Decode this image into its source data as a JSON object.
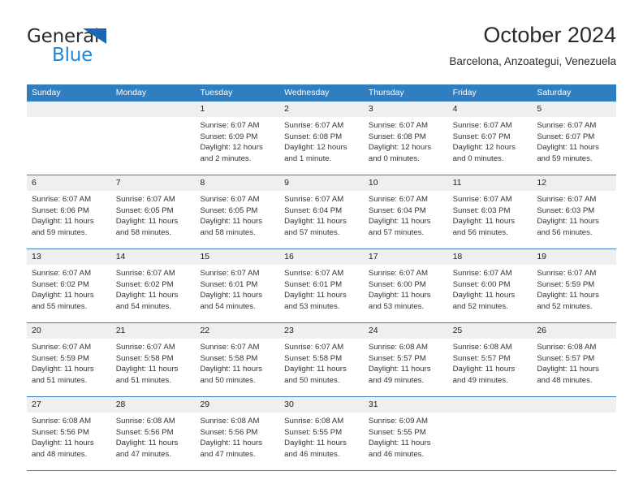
{
  "brand": {
    "word1": "General",
    "word2": "Blue",
    "triangle_color": "#1a68b3",
    "blue_text_color": "#1f86d8"
  },
  "header": {
    "title": "October 2024",
    "subtitle": "Barcelona, Anzoategui, Venezuela"
  },
  "colors": {
    "header_row_bg": "#2f7ec1",
    "header_row_text": "#ffffff",
    "daynum_band_bg": "#efefef",
    "week_divider": "#3a7ebf",
    "cell_bg": "#ffffff",
    "body_text": "#333333"
  },
  "weekdays": [
    "Sunday",
    "Monday",
    "Tuesday",
    "Wednesday",
    "Thursday",
    "Friday",
    "Saturday"
  ],
  "weeks": [
    [
      {
        "day": "",
        "lines": []
      },
      {
        "day": "",
        "lines": []
      },
      {
        "day": "1",
        "lines": [
          "Sunrise: 6:07 AM",
          "Sunset: 6:09 PM",
          "Daylight: 12 hours",
          "and 2 minutes."
        ]
      },
      {
        "day": "2",
        "lines": [
          "Sunrise: 6:07 AM",
          "Sunset: 6:08 PM",
          "Daylight: 12 hours",
          "and 1 minute."
        ]
      },
      {
        "day": "3",
        "lines": [
          "Sunrise: 6:07 AM",
          "Sunset: 6:08 PM",
          "Daylight: 12 hours",
          "and 0 minutes."
        ]
      },
      {
        "day": "4",
        "lines": [
          "Sunrise: 6:07 AM",
          "Sunset: 6:07 PM",
          "Daylight: 12 hours",
          "and 0 minutes."
        ]
      },
      {
        "day": "5",
        "lines": [
          "Sunrise: 6:07 AM",
          "Sunset: 6:07 PM",
          "Daylight: 11 hours",
          "and 59 minutes."
        ]
      }
    ],
    [
      {
        "day": "6",
        "lines": [
          "Sunrise: 6:07 AM",
          "Sunset: 6:06 PM",
          "Daylight: 11 hours",
          "and 59 minutes."
        ]
      },
      {
        "day": "7",
        "lines": [
          "Sunrise: 6:07 AM",
          "Sunset: 6:05 PM",
          "Daylight: 11 hours",
          "and 58 minutes."
        ]
      },
      {
        "day": "8",
        "lines": [
          "Sunrise: 6:07 AM",
          "Sunset: 6:05 PM",
          "Daylight: 11 hours",
          "and 58 minutes."
        ]
      },
      {
        "day": "9",
        "lines": [
          "Sunrise: 6:07 AM",
          "Sunset: 6:04 PM",
          "Daylight: 11 hours",
          "and 57 minutes."
        ]
      },
      {
        "day": "10",
        "lines": [
          "Sunrise: 6:07 AM",
          "Sunset: 6:04 PM",
          "Daylight: 11 hours",
          "and 57 minutes."
        ]
      },
      {
        "day": "11",
        "lines": [
          "Sunrise: 6:07 AM",
          "Sunset: 6:03 PM",
          "Daylight: 11 hours",
          "and 56 minutes."
        ]
      },
      {
        "day": "12",
        "lines": [
          "Sunrise: 6:07 AM",
          "Sunset: 6:03 PM",
          "Daylight: 11 hours",
          "and 56 minutes."
        ]
      }
    ],
    [
      {
        "day": "13",
        "lines": [
          "Sunrise: 6:07 AM",
          "Sunset: 6:02 PM",
          "Daylight: 11 hours",
          "and 55 minutes."
        ]
      },
      {
        "day": "14",
        "lines": [
          "Sunrise: 6:07 AM",
          "Sunset: 6:02 PM",
          "Daylight: 11 hours",
          "and 54 minutes."
        ]
      },
      {
        "day": "15",
        "lines": [
          "Sunrise: 6:07 AM",
          "Sunset: 6:01 PM",
          "Daylight: 11 hours",
          "and 54 minutes."
        ]
      },
      {
        "day": "16",
        "lines": [
          "Sunrise: 6:07 AM",
          "Sunset: 6:01 PM",
          "Daylight: 11 hours",
          "and 53 minutes."
        ]
      },
      {
        "day": "17",
        "lines": [
          "Sunrise: 6:07 AM",
          "Sunset: 6:00 PM",
          "Daylight: 11 hours",
          "and 53 minutes."
        ]
      },
      {
        "day": "18",
        "lines": [
          "Sunrise: 6:07 AM",
          "Sunset: 6:00 PM",
          "Daylight: 11 hours",
          "and 52 minutes."
        ]
      },
      {
        "day": "19",
        "lines": [
          "Sunrise: 6:07 AM",
          "Sunset: 5:59 PM",
          "Daylight: 11 hours",
          "and 52 minutes."
        ]
      }
    ],
    [
      {
        "day": "20",
        "lines": [
          "Sunrise: 6:07 AM",
          "Sunset: 5:59 PM",
          "Daylight: 11 hours",
          "and 51 minutes."
        ]
      },
      {
        "day": "21",
        "lines": [
          "Sunrise: 6:07 AM",
          "Sunset: 5:58 PM",
          "Daylight: 11 hours",
          "and 51 minutes."
        ]
      },
      {
        "day": "22",
        "lines": [
          "Sunrise: 6:07 AM",
          "Sunset: 5:58 PM",
          "Daylight: 11 hours",
          "and 50 minutes."
        ]
      },
      {
        "day": "23",
        "lines": [
          "Sunrise: 6:07 AM",
          "Sunset: 5:58 PM",
          "Daylight: 11 hours",
          "and 50 minutes."
        ]
      },
      {
        "day": "24",
        "lines": [
          "Sunrise: 6:08 AM",
          "Sunset: 5:57 PM",
          "Daylight: 11 hours",
          "and 49 minutes."
        ]
      },
      {
        "day": "25",
        "lines": [
          "Sunrise: 6:08 AM",
          "Sunset: 5:57 PM",
          "Daylight: 11 hours",
          "and 49 minutes."
        ]
      },
      {
        "day": "26",
        "lines": [
          "Sunrise: 6:08 AM",
          "Sunset: 5:57 PM",
          "Daylight: 11 hours",
          "and 48 minutes."
        ]
      }
    ],
    [
      {
        "day": "27",
        "lines": [
          "Sunrise: 6:08 AM",
          "Sunset: 5:56 PM",
          "Daylight: 11 hours",
          "and 48 minutes."
        ]
      },
      {
        "day": "28",
        "lines": [
          "Sunrise: 6:08 AM",
          "Sunset: 5:56 PM",
          "Daylight: 11 hours",
          "and 47 minutes."
        ]
      },
      {
        "day": "29",
        "lines": [
          "Sunrise: 6:08 AM",
          "Sunset: 5:56 PM",
          "Daylight: 11 hours",
          "and 47 minutes."
        ]
      },
      {
        "day": "30",
        "lines": [
          "Sunrise: 6:08 AM",
          "Sunset: 5:55 PM",
          "Daylight: 11 hours",
          "and 46 minutes."
        ]
      },
      {
        "day": "31",
        "lines": [
          "Sunrise: 6:09 AM",
          "Sunset: 5:55 PM",
          "Daylight: 11 hours",
          "and 46 minutes."
        ]
      },
      {
        "day": "",
        "lines": []
      },
      {
        "day": "",
        "lines": []
      }
    ]
  ]
}
